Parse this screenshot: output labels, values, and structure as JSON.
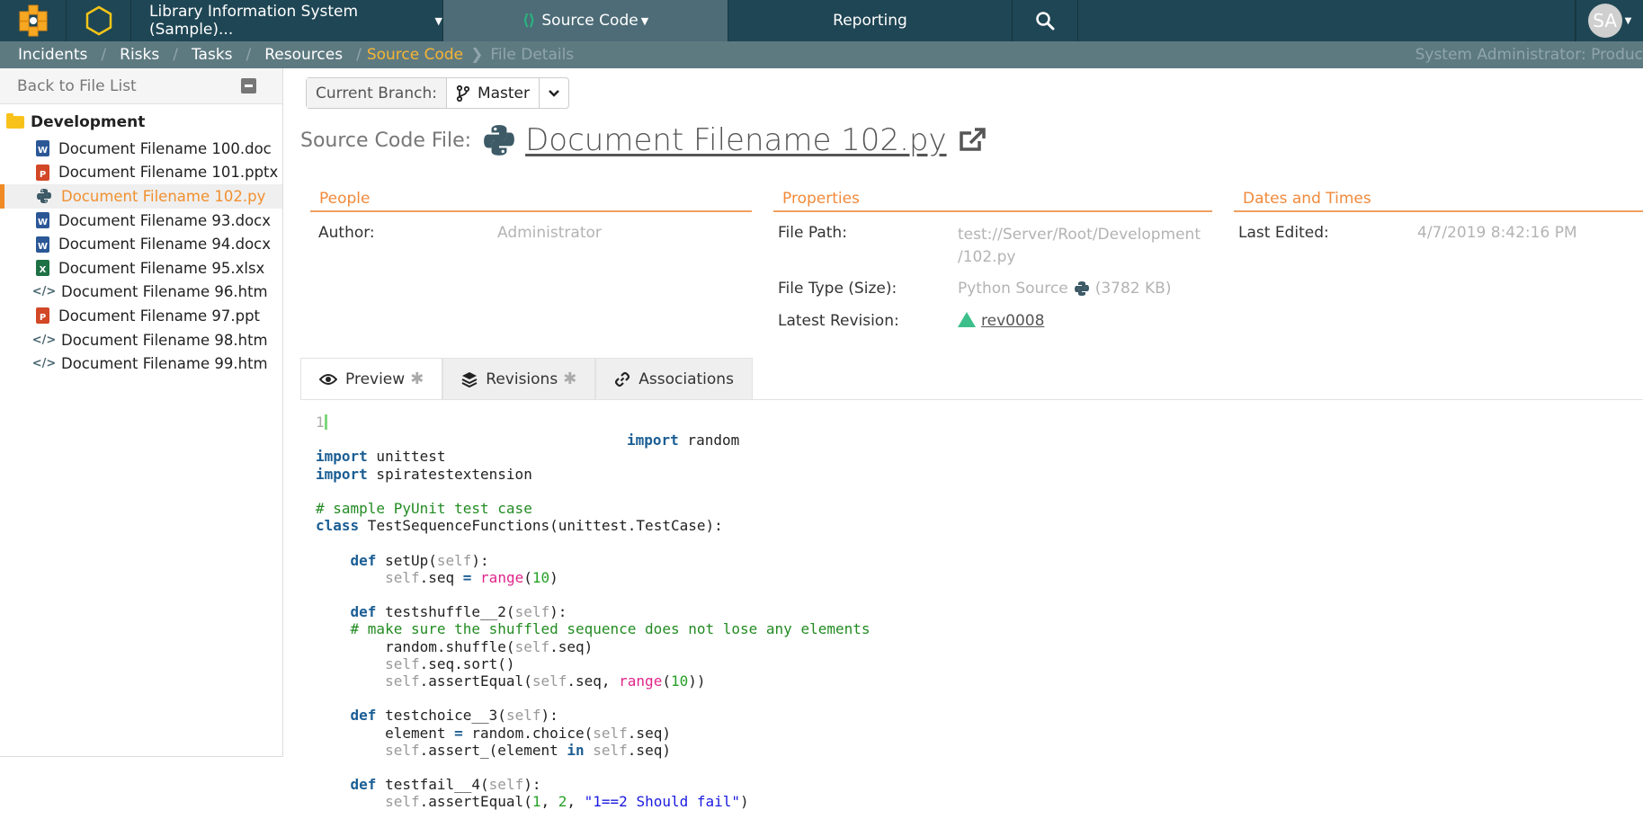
{
  "topnav": {
    "project": "Library Information System (Sample)...",
    "source_code": "Source Code",
    "reporting": "Reporting",
    "avatar_initials": "SA"
  },
  "breadcrumb": {
    "items": [
      "Incidents",
      "Risks",
      "Tasks",
      "Resources"
    ],
    "active": "Source Code",
    "current": "File Details",
    "user": "System Administrator: Produc"
  },
  "sidebar": {
    "back_label": "Back to File List",
    "folder": "Development",
    "files": [
      {
        "name": "Document Filename 100.doc",
        "type": "doc"
      },
      {
        "name": "Document Filename 101.pptx",
        "type": "ppt"
      },
      {
        "name": "Document Filename 102.py",
        "type": "py",
        "selected": true
      },
      {
        "name": "Document Filename 93.docx",
        "type": "doc"
      },
      {
        "name": "Document Filename 94.docx",
        "type": "doc"
      },
      {
        "name": "Document Filename 95.xlsx",
        "type": "xls"
      },
      {
        "name": "Document Filename 96.htm",
        "type": "htm"
      },
      {
        "name": "Document Filename 97.ppt",
        "type": "ppt"
      },
      {
        "name": "Document Filename 98.htm",
        "type": "htm"
      },
      {
        "name": "Document Filename 99.htm",
        "type": "htm"
      }
    ]
  },
  "branch": {
    "label": "Current Branch:",
    "value": "Master"
  },
  "title": {
    "label": "Source Code File:",
    "name": "Document Filename 102.py"
  },
  "people": {
    "heading": "People",
    "author_label": "Author:",
    "author_value": "Administrator"
  },
  "properties": {
    "heading": "Properties",
    "path_label": "File Path:",
    "path_line1": "test://Server/Root/Development",
    "path_line2": "/102.py",
    "type_label": "File Type (Size):",
    "type_value": "Python Source",
    "size_value": "(3782 KB)",
    "revision_label": "Latest Revision:",
    "revision_value": "rev0008"
  },
  "dates": {
    "heading": "Dates and Times",
    "edited_label": "Last Edited:",
    "edited_value": "4/7/2019 8:42:16 PM"
  },
  "tabs": [
    {
      "label": "Preview",
      "star": "✱"
    },
    {
      "label": "Revisions",
      "star": "✱"
    },
    {
      "label": "Associations"
    }
  ],
  "code": {
    "line_number": "1",
    "first_line": "import random"
  },
  "colors": {
    "nav_bg": "#1f4654",
    "accent_orange": "#f08a24",
    "breadcrumb_active": "#f5b534",
    "revision_green": "#3cbf8a"
  }
}
